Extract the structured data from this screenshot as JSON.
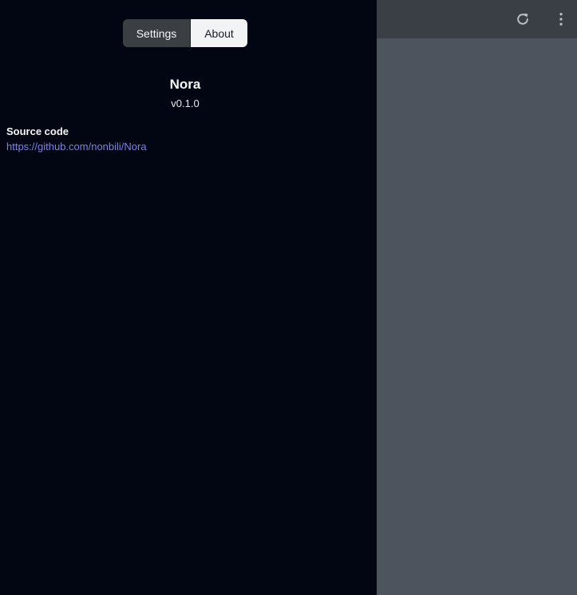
{
  "tabs": {
    "settings_label": "Settings",
    "about_label": "About",
    "active": "About"
  },
  "about": {
    "app_name": "Nora",
    "version": "v0.1.0",
    "source_label": "Source code",
    "source_url": "https://github.com/nonbili/Nora"
  },
  "toolbar": {
    "refresh_icon": "refresh-icon",
    "menu_icon": "more-vertical-icon"
  },
  "colors": {
    "drawer_bg": "#010612",
    "main_bg": "#4d545e",
    "toolbar_bg": "#3a3f46",
    "link": "#7b82ea"
  }
}
